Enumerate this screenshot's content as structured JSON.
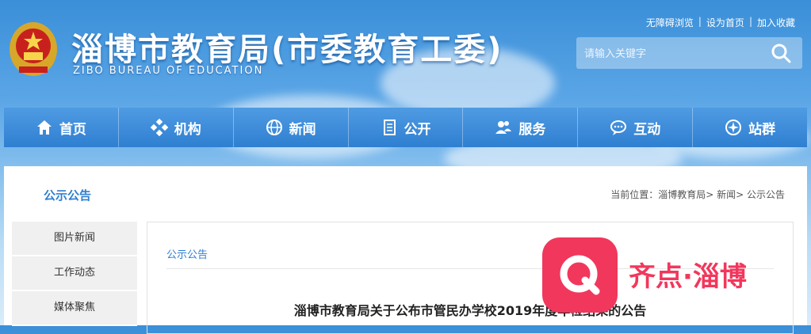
{
  "header": {
    "title": "淄博市教育局(市委教育工委)",
    "subtitle": "ZIBO BUREAU OF EDUCATION",
    "top_links": [
      "无障碍浏览",
      "设为首页",
      "加入收藏"
    ],
    "search_placeholder": "请输入关键字"
  },
  "nav": [
    {
      "label": "首页",
      "icon": "home-icon"
    },
    {
      "label": "机构",
      "icon": "organization-icon"
    },
    {
      "label": "新闻",
      "icon": "globe-icon"
    },
    {
      "label": "公开",
      "icon": "document-icon"
    },
    {
      "label": "服务",
      "icon": "users-icon"
    },
    {
      "label": "互动",
      "icon": "chat-icon"
    },
    {
      "label": "站群",
      "icon": "compass-icon"
    }
  ],
  "page": {
    "section_title": "公示公告",
    "breadcrumb": "当前位置：淄博教育局> 新闻> 公示公告",
    "sidebar": [
      "图片新闻",
      "工作动态",
      "媒体聚焦"
    ],
    "main_title": "公示公告",
    "article_title": "淄博市教育局关于公布市管民办学校2019年度年检结果的公告"
  },
  "watermark": {
    "text": "齐点·淄博"
  },
  "colors": {
    "accent": "#2f7fd1",
    "watermark": "#f2375c"
  }
}
